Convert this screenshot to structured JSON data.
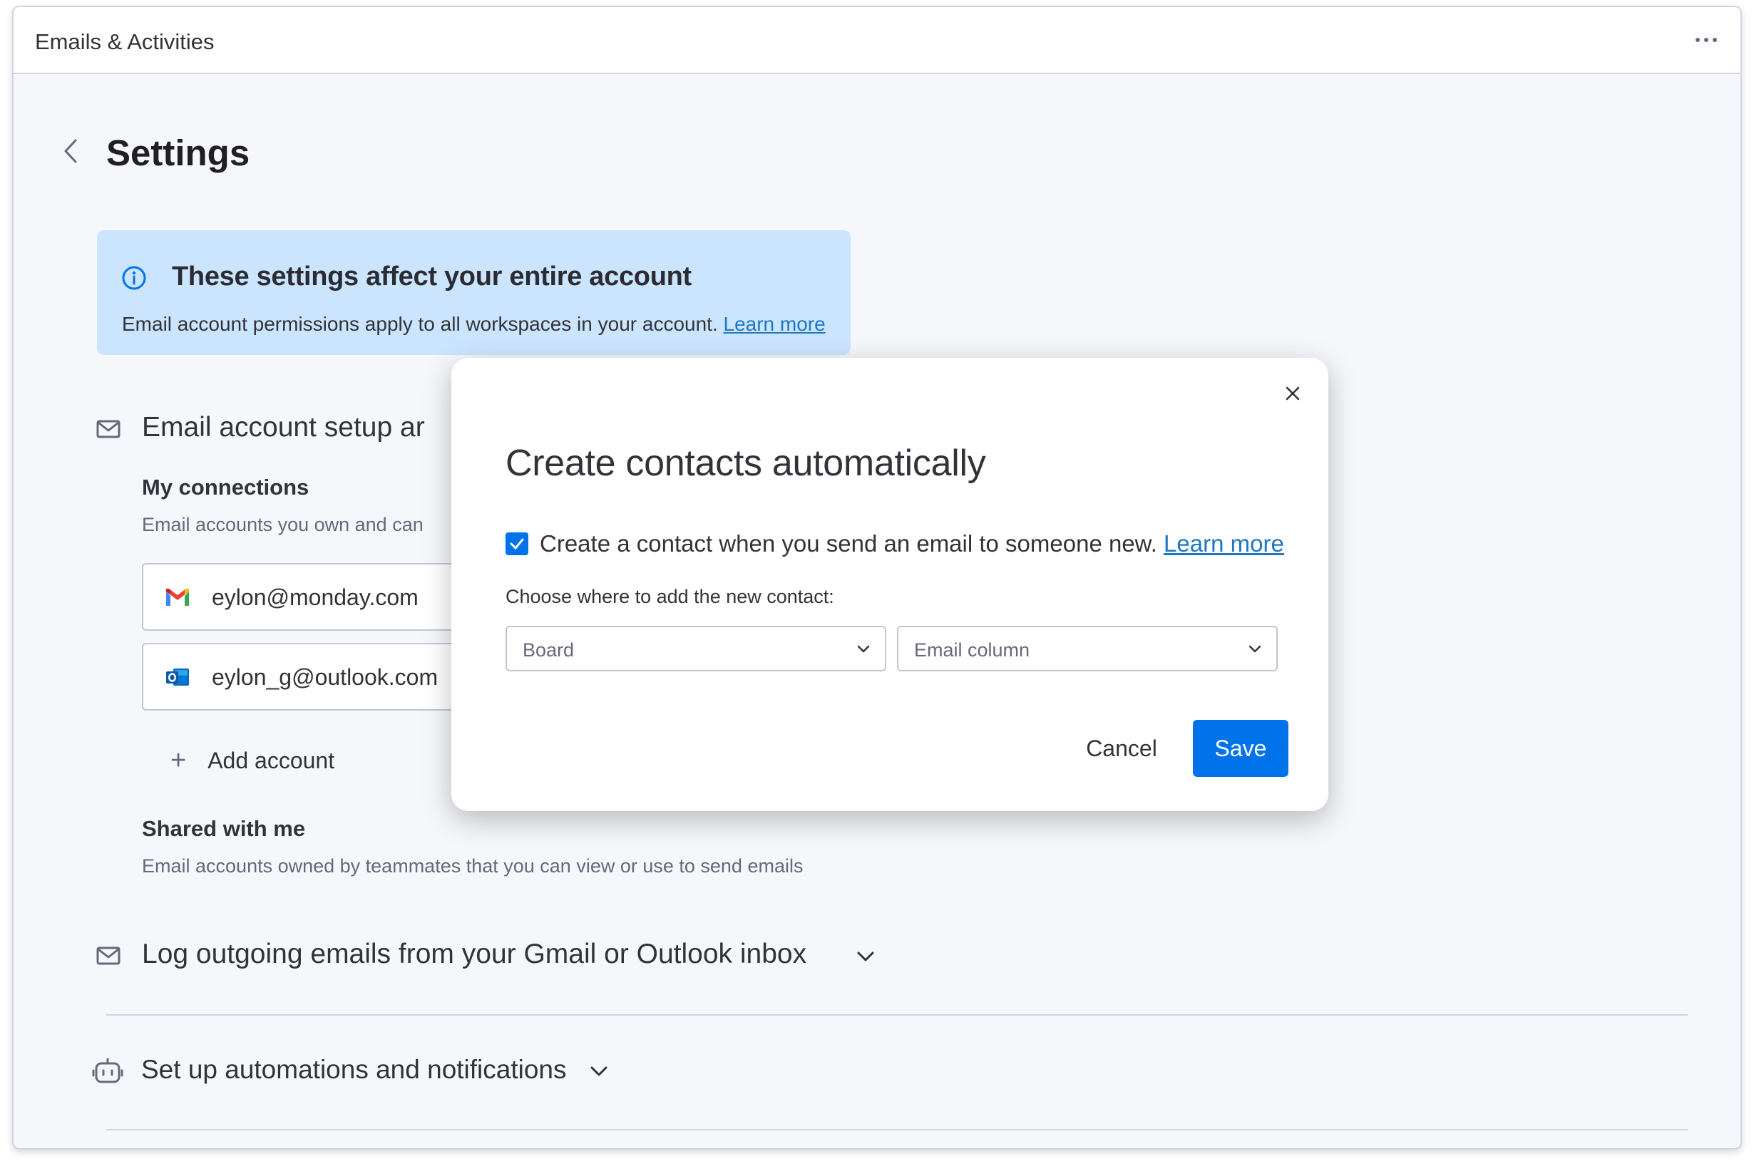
{
  "window": {
    "title": "Emails & Activities"
  },
  "page": {
    "title": "Settings"
  },
  "info_banner": {
    "heading": "These settings affect your entire account",
    "body": "Email account permissions apply to all workspaces in your account. ",
    "link": "Learn more"
  },
  "email_setup": {
    "title": "Email account setup ar",
    "my_connections": {
      "title": "My connections",
      "description": "Email accounts you own and can"
    },
    "accounts": [
      {
        "email": "eylon@monday.com",
        "icon": "gmail-icon"
      },
      {
        "email": "eylon_g@outlook.com",
        "icon": "outlook-icon"
      }
    ],
    "add_account_label": "Add account",
    "shared_with_me": {
      "title": "Shared with me",
      "description": "Email accounts owned by teammates that you can view or use to send emails"
    }
  },
  "sections": {
    "log_outgoing": "Log outgoing emails from your Gmail or Outlook inbox",
    "automations": "Set up automations and notifications"
  },
  "modal": {
    "title": "Create contacts automatically",
    "checkbox_checked": true,
    "checkbox_label": "Create a contact when you send an email to someone new. ",
    "checkbox_link": "Learn more",
    "choose_label": "Choose where to add the new contact:",
    "board_select": "Board",
    "column_select": "Email column",
    "cancel_label": "Cancel",
    "save_label": "Save"
  },
  "colors": {
    "primary": "#0073ea",
    "banner_bg": "#cce5ff",
    "link": "#1f76c2",
    "page_bg": "#f6f7fb"
  }
}
